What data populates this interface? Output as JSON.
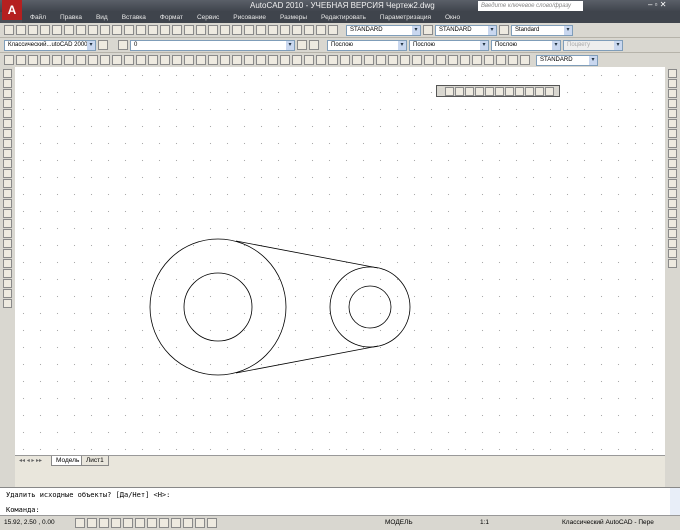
{
  "app": {
    "title": "AutoCAD 2010 - УЧЕБНАЯ ВЕРСИЯ    Чертеж2.dwg",
    "logo": "A",
    "search_placeholder": "Введите ключевое слово/фразу"
  },
  "menu": [
    "Файл",
    "Правка",
    "Вид",
    "Вставка",
    "Формат",
    "Сервис",
    "Рисование",
    "Размеры",
    "Редактировать",
    "Параметризация",
    "Окно"
  ],
  "toolbar1": {
    "text_style": "STANDARD",
    "dim_style": "STANDARD",
    "table_style": "Standard"
  },
  "toolbar2": {
    "workspace": "Классический...utoCAD 2000",
    "layer": "0",
    "color": "Послою",
    "linetype": "Послою",
    "lineweight": "Послою",
    "plotstyle": "Поцвету"
  },
  "toolbar3": {
    "dim_style": "STANDARD"
  },
  "tabs": [
    "Модель",
    "Лист1"
  ],
  "command": {
    "history": "Удалить исходные объекты? [Да/Нет] <Н>:",
    "prompt": "Команда:"
  },
  "status": {
    "coords": "15.92, 2.50 , 0.00",
    "model": "МОДЕЛЬ",
    "scale": "1:1",
    "workspace": "Классический AutoCAD - Пере"
  }
}
